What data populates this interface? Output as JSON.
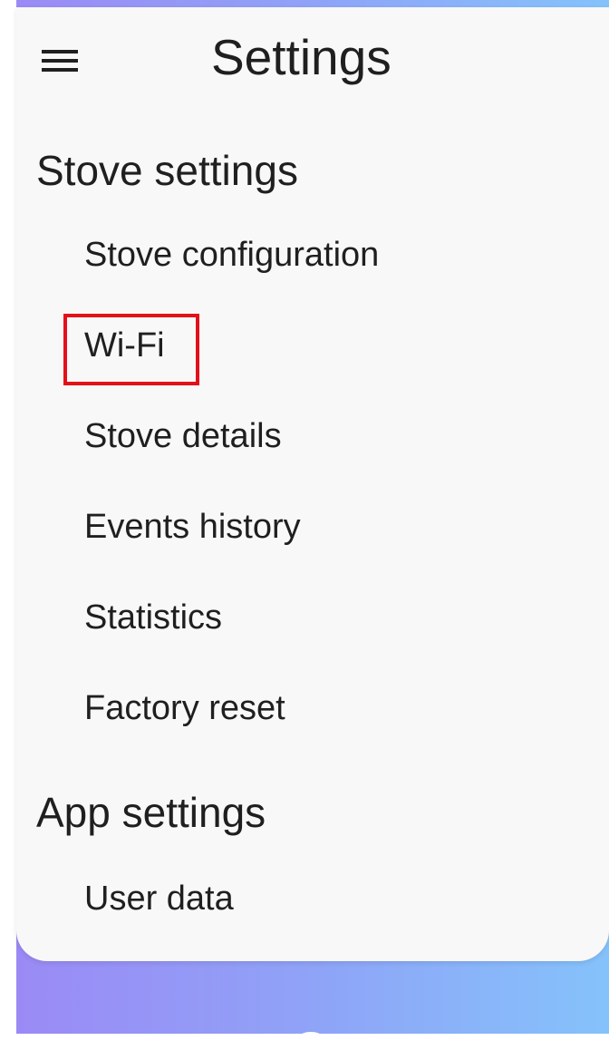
{
  "header": {
    "title": "Settings",
    "menu_icon": "menu-icon"
  },
  "sections": [
    {
      "title": "Stove settings",
      "items": [
        {
          "label": "Stove configuration"
        },
        {
          "label": "Wi-Fi",
          "highlighted": true
        },
        {
          "label": "Stove details"
        },
        {
          "label": "Events history"
        },
        {
          "label": "Statistics"
        },
        {
          "label": "Factory reset"
        }
      ]
    },
    {
      "title": "App settings",
      "items": [
        {
          "label": "User data"
        }
      ]
    }
  ],
  "colors": {
    "highlight_border": "#e3101b",
    "card_background": "#f8f8f8",
    "gradient_start": "#9b8af5",
    "gradient_end": "#85c2fb"
  }
}
